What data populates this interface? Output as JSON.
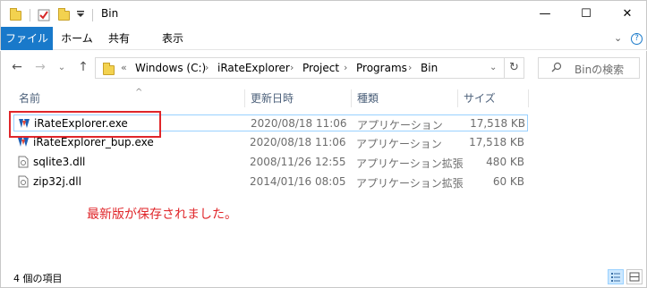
{
  "window": {
    "title": "Bin",
    "minimize_glyph": "—",
    "maximize_glyph": "☐",
    "close_glyph": "✕"
  },
  "ribbon": {
    "tabs": [
      "ファイル",
      "ホーム",
      "共有",
      "表示"
    ],
    "expand_glyph": "⌄",
    "help_glyph": "?"
  },
  "address": {
    "overflow": "«",
    "segments": [
      "Windows (C:)",
      "iRateExplorer",
      "Project",
      "Programs",
      "Bin"
    ],
    "chevron": "›",
    "dropdown_glyph": "⌄",
    "refresh_glyph": "↻"
  },
  "nav": {
    "back_glyph": "←",
    "forward_glyph": "→",
    "recent_glyph": "⌄",
    "up_glyph": "↑"
  },
  "search": {
    "placeholder": "Binの検索",
    "icon": "search-icon"
  },
  "columns": {
    "name": "名前",
    "modified": "更新日時",
    "type": "種類",
    "size": "サイズ",
    "sort_glyph": "^"
  },
  "files": [
    {
      "name": "iRateExplorer.exe",
      "modified": "2020/08/18 11:06",
      "type": "アプリケーション",
      "size": "17,518 KB",
      "icon": "exe-icon"
    },
    {
      "name": "iRateExplorer_bup.exe",
      "modified": "2020/08/18 11:06",
      "type": "アプリケーション",
      "size": "17,518 KB",
      "icon": "exe-icon"
    },
    {
      "name": "sqlite3.dll",
      "modified": "2008/11/26 12:55",
      "type": "アプリケーション拡張",
      "size": "480 KB",
      "icon": "dll-icon"
    },
    {
      "name": "zip32j.dll",
      "modified": "2014/01/16 08:05",
      "type": "アプリケーション拡張",
      "size": "60 KB",
      "icon": "dll-icon"
    }
  ],
  "annotation": "最新版が保存されました。",
  "status": {
    "item_count": "4 個の項目"
  },
  "colors": {
    "accent": "#1979ca",
    "annotation_red": "#e0262a",
    "selection_border": "#99d1ff"
  }
}
